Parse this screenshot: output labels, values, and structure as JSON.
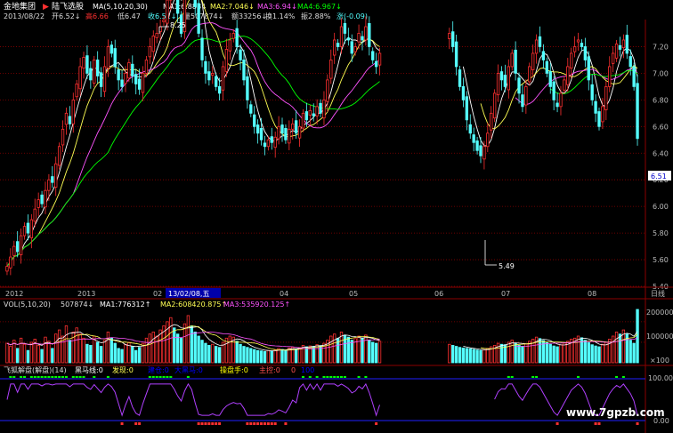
{
  "header": {
    "stock_name": "金地集团",
    "arrow": "▶",
    "indicator_name": "陆飞选股",
    "ma_params": "MA(5,10,20,30)",
    "ma1": "MA1:6.888↓",
    "ma2": "MA2:7.046↓",
    "ma3": "MA3:6.94↓",
    "ma4": "MA4:6.967↓",
    "date": "2013/08/22",
    "open": "开6.52↓",
    "high": "高6.66",
    "low": "低6.47",
    "close": "收6.51↓",
    "volume": "量507874↓",
    "amount": "额33256↓",
    "turnover": "换1.14%",
    "amplitude": "振2.88%",
    "change": "涨(-0.09)"
  },
  "price_panel": {
    "high_annotation": "8.25",
    "low_annotation": "5.49",
    "current_price": "6.51",
    "y_ticks": [
      "7.20",
      "7.00",
      "6.80",
      "6.60",
      "6.40",
      "6.20",
      "6.00",
      "5.80",
      "5.60",
      "5.40"
    ]
  },
  "time_axis": {
    "labels": [
      "2012",
      "2013",
      "02",
      "13/02/08,五",
      "04",
      "05",
      "06",
      "07",
      "08"
    ],
    "right_label": "日线"
  },
  "volume_panel": {
    "title": "VOL(5,10,20)",
    "vol": "507874↓",
    "ma1": "MA1:776312↑",
    "ma2": "MA2:608420.875↑",
    "ma3": "MA3:535920.125↑",
    "y_ticks": [
      "200000",
      "100000",
      "×100"
    ]
  },
  "indicator_panel": {
    "title": "飞狐解盘(解盘)(14)",
    "label_black_horse": "黑马线:0",
    "label_found": "发现:0",
    "label_3": "建仓:0",
    "label_4": "大黑马:0",
    "label_5": "操盘手:0",
    "label_6": "主控:0",
    "label_7": "0",
    "label_8": "100",
    "y_ticks": [
      "100.00",
      "0.00"
    ]
  },
  "watermark": "www.7gpzb.com",
  "colors": {
    "up": "#ff3030",
    "down": "#54ffff",
    "ma1": "#ffffff",
    "ma2": "#ffff54",
    "ma3": "#ff54ff",
    "ma4": "#00ff00",
    "grid": "#8b0000",
    "indicator_line": "#b040ff"
  },
  "chart_data": {
    "type": "candlestick",
    "date": "2013/08/22",
    "ma_periods": [
      5,
      10,
      20,
      30
    ],
    "price_ylim": [
      5.4,
      7.35
    ],
    "volume_ylim": [
      0,
      260000
    ],
    "indicator_ylim": [
      -30,
      130
    ],
    "closes": [
      5.55,
      5.62,
      5.7,
      5.66,
      5.78,
      5.85,
      5.8,
      5.9,
      5.98,
      6.05,
      6.02,
      6.12,
      6.2,
      6.18,
      6.32,
      6.45,
      6.58,
      6.7,
      6.62,
      6.8,
      6.92,
      7.05,
      7.12,
      7.0,
      6.95,
      7.1,
      6.98,
      6.9,
      7.05,
      7.2,
      7.15,
      7.05,
      6.95,
      6.9,
      7.0,
      7.08,
      6.98,
      6.92,
      6.88,
      7.0,
      7.1,
      7.2,
      7.28,
      7.3,
      7.35,
      7.4,
      7.55,
      7.8,
      7.65,
      7.45,
      7.3,
      7.6,
      7.95,
      7.8,
      7.5,
      7.3,
      7.1,
      7.0,
      6.95,
      7.0,
      6.9,
      6.85,
      7.05,
      7.18,
      7.25,
      7.3,
      7.2,
      7.1,
      6.95,
      6.8,
      6.7,
      6.6,
      6.55,
      6.5,
      6.45,
      6.5,
      6.48,
      6.52,
      6.6,
      6.55,
      6.5,
      6.58,
      6.62,
      6.55,
      6.6,
      6.7,
      6.65,
      6.72,
      6.68,
      6.75,
      6.7,
      6.8,
      6.95,
      7.1,
      7.25,
      7.2,
      7.35,
      7.3,
      7.25,
      7.15,
      7.2,
      7.3,
      7.25,
      7.35,
      7.2,
      7.1,
      7.05,
      7.15,
      null,
      null,
      null,
      null,
      null,
      null,
      null,
      null,
      null,
      null,
      null,
      null,
      null,
      null,
      null,
      null,
      null,
      null,
      null,
      7.3,
      7.2,
      7.05,
      6.9,
      6.8,
      6.65,
      6.55,
      6.48,
      6.42,
      6.38,
      6.45,
      6.55,
      6.7,
      6.85,
      7.0,
      6.95,
      6.9,
      7.05,
      7.15,
      7.0,
      6.85,
      6.75,
      6.9,
      7.05,
      7.15,
      7.25,
      7.2,
      7.1,
      7.0,
      6.9,
      6.8,
      6.75,
      6.85,
      6.95,
      7.05,
      7.15,
      7.2,
      7.25,
      7.2,
      7.1,
      6.95,
      6.8,
      6.7,
      6.6,
      6.75,
      6.9,
      7.05,
      7.15,
      7.22,
      7.18,
      7.25,
      7.15,
      7.05,
      6.9,
      6.51
    ],
    "volumes": [
      95000,
      80000,
      110000,
      70000,
      120000,
      90000,
      60000,
      100000,
      115000,
      85000,
      65000,
      125000,
      105000,
      70000,
      140000,
      160000,
      130000,
      180000,
      110000,
      150000,
      170000,
      140000,
      120000,
      90000,
      85000,
      130000,
      100000,
      80000,
      110000,
      150000,
      120000,
      95000,
      70000,
      65000,
      90000,
      100000,
      80000,
      60000,
      75000,
      95000,
      120000,
      140000,
      150000,
      130000,
      160000,
      180000,
      200000,
      220000,
      170000,
      140000,
      120000,
      190000,
      230000,
      180000,
      150000,
      130000,
      110000,
      95000,
      85000,
      90000,
      80000,
      75000,
      100000,
      120000,
      130000,
      125000,
      105000,
      90000,
      80000,
      75000,
      70000,
      65000,
      60000,
      58000,
      55000,
      60000,
      58000,
      62000,
      70000,
      65000,
      60000,
      72000,
      76000,
      68000,
      74000,
      85000,
      78000,
      82000,
      80000,
      88000,
      84000,
      95000,
      110000,
      130000,
      140000,
      120000,
      150000,
      135000,
      125000,
      110000,
      118000,
      130000,
      120000,
      135000,
      110000,
      100000,
      95000,
      105000,
      null,
      null,
      null,
      null,
      null,
      null,
      null,
      null,
      null,
      null,
      null,
      null,
      null,
      null,
      null,
      null,
      null,
      null,
      null,
      90000,
      85000,
      80000,
      75000,
      72000,
      70000,
      68000,
      65000,
      62000,
      60000,
      64000,
      70000,
      78000,
      85000,
      95000,
      90000,
      88000,
      100000,
      110000,
      95000,
      85000,
      80000,
      92000,
      105000,
      115000,
      125000,
      118000,
      108000,
      98000,
      90000,
      82000,
      78000,
      88000,
      96000,
      105000,
      115000,
      120000,
      130000,
      122000,
      110000,
      98000,
      88000,
      82000,
      78000,
      90000,
      100000,
      115000,
      130000,
      150000,
      140000,
      160000,
      140000,
      110000,
      95000,
      507874
    ]
  }
}
